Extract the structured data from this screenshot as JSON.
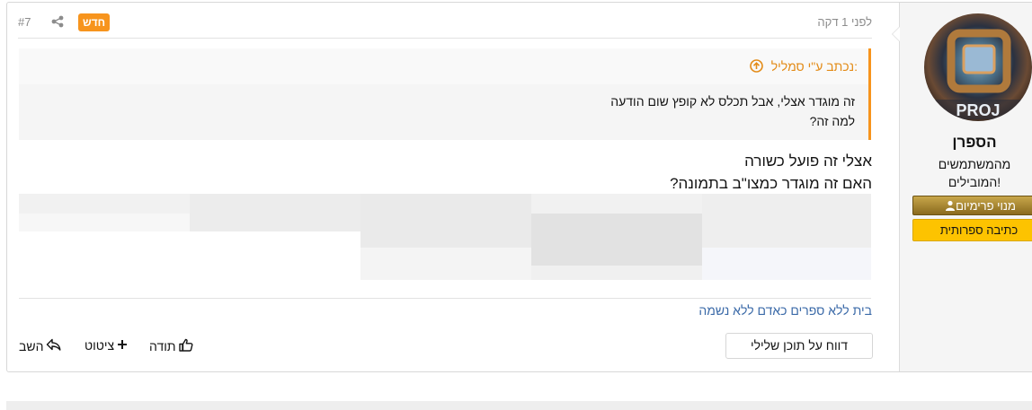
{
  "post": {
    "number": "#7",
    "new_badge": "חדש",
    "time": "לפני 1 דקה",
    "quote": {
      "author_label": "נכתב ע\"י סמליל:",
      "lines": [
        "זה מוגדר אצלי, אבל תכלס לא קופץ שום הודעה",
        "למה זה?"
      ]
    },
    "body_lines": [
      "אצלי זה פועל כשורה",
      "האם זה מוגדר כמצו\"ב בתמונה?"
    ],
    "signature": "בית ללא ספרים כאדם ללא נשמה",
    "actions": {
      "report": "דווח על תוכן שלילי",
      "thanks": "תודה",
      "quote": "ציטוט",
      "reply": "השב"
    }
  },
  "user": {
    "name": "הספרן",
    "title_line1": "מהמשתמשים",
    "title_line2": "המובילים!",
    "banner1": "מנוי פרימיום",
    "banner2": "כתיבה ספרותית",
    "avatar_text": "PROJ"
  },
  "colors": {
    "accent": "#f7941d",
    "link": "#3b6aa8",
    "banner_gold": "#fdc300"
  }
}
